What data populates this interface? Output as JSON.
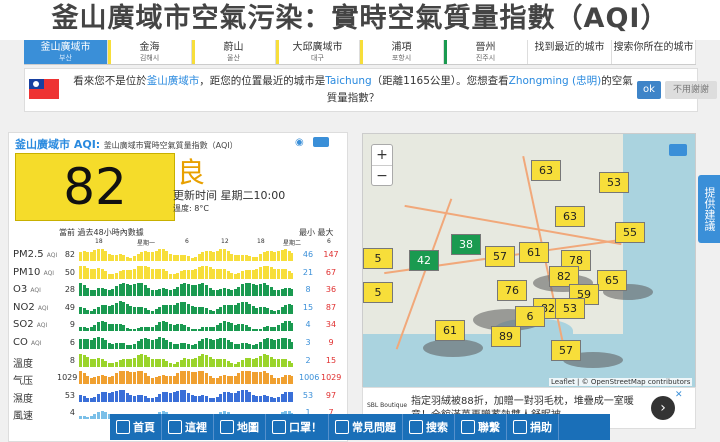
{
  "page_title": "釜山廣域市空氣污染：實時空氣質量指數（AQI）",
  "nav": [
    {
      "label": "釜山廣域市",
      "sub": "부산",
      "active": true,
      "color": ""
    },
    {
      "label": "金海",
      "sub": "김해시",
      "active": false,
      "color": "#f7de3a"
    },
    {
      "label": "蔚山",
      "sub": "울산",
      "active": false,
      "color": "#f7de3a"
    },
    {
      "label": "大邱廣域市",
      "sub": "대구",
      "active": false,
      "color": "#f7de3a"
    },
    {
      "label": "浦項",
      "sub": "포항시",
      "active": false,
      "color": "#f7de3a"
    },
    {
      "label": "晉州",
      "sub": "진주시",
      "active": false,
      "color": "#1a9a50"
    },
    {
      "label": "找到最近的城市",
      "sub": "",
      "active": false,
      "color": ""
    },
    {
      "label": "搜索你所在的城市",
      "sub": "",
      "active": false,
      "color": ""
    }
  ],
  "notice": {
    "part1": "看來您不是位於",
    "city_link": "釜山廣域市",
    "part2": "，距您的位置最近的城市是",
    "near_city": "Taichung",
    "part3": "（距離1165公里）。您想查看",
    "zh_link": "Zhongming (忠明)",
    "part4": "的空氣質量指數？",
    "ok": "ok",
    "no": "不用謝謝"
  },
  "card": {
    "city": "釜山廣域市 AQI:",
    "subtitle": "釜山廣域市實時空氣質量指數（AQI）",
    "aqi": "82",
    "level": "良",
    "updated": "更新时间 星期二10:00",
    "temp": "溫度: 8°C",
    "hdr_now": "當前 過去48小時內數據",
    "hdr_minmax": "最小 最大",
    "ticks": [
      "18",
      "星期一",
      "6",
      "12",
      "18",
      "星期二",
      "6"
    ]
  },
  "rows": [
    {
      "label": "PM2.5",
      "unit": "AQI",
      "current": "82",
      "min": "46",
      "max": "147",
      "color": "#f7de3a",
      "level": 0.6
    },
    {
      "label": "PM10",
      "unit": "AQI",
      "current": "50",
      "min": "21",
      "max": "67",
      "color": "#f7de3a",
      "level": 0.7
    },
    {
      "label": "O3",
      "unit": "AQI",
      "current": "28",
      "min": "8",
      "max": "36",
      "color": "#1a9a50",
      "level": 0.75
    },
    {
      "label": "NO2",
      "unit": "AQI",
      "current": "49",
      "min": "15",
      "max": "87",
      "color": "#1a9a50",
      "level": 0.6
    },
    {
      "label": "SO2",
      "unit": "AQI",
      "current": "9",
      "min": "4",
      "max": "34",
      "color": "#1a9a50",
      "level": 0.45
    },
    {
      "label": "CO",
      "unit": "AQI",
      "current": "6",
      "min": "3",
      "max": "9",
      "color": "#1a9a50",
      "level": 0.6
    },
    {
      "label": "溫度",
      "unit": "",
      "current": "8",
      "min": "2",
      "max": "15",
      "color": "#9ad42a",
      "level": 0.6
    },
    {
      "label": "气压",
      "unit": "",
      "current": "1029",
      "min": "1006",
      "max": "1029",
      "color": "#f0a030",
      "level": 0.8
    },
    {
      "label": "濕度",
      "unit": "",
      "current": "53",
      "min": "53",
      "max": "97",
      "color": "#3a6fd8",
      "level": 0.6
    },
    {
      "label": "風速",
      "unit": "",
      "current": "4",
      "min": "1",
      "max": "7",
      "color": "#7abfe8",
      "level": 0.3
    }
  ],
  "map": {
    "zoom_in": "+",
    "zoom_out": "−",
    "attribution": "Leaflet | © OpenStreetMap contributors",
    "markers": [
      {
        "v": "63",
        "c": "yellow"
      },
      {
        "v": "53",
        "c": "yellow"
      },
      {
        "v": "63",
        "c": "yellow"
      },
      {
        "v": "55",
        "c": "yellow"
      },
      {
        "v": "38",
        "c": "green"
      },
      {
        "v": "42",
        "c": "green"
      },
      {
        "v": "57",
        "c": "yellow"
      },
      {
        "v": "61",
        "c": "yellow"
      },
      {
        "v": "78",
        "c": "yellow"
      },
      {
        "v": "82",
        "c": "yellow"
      },
      {
        "v": "65",
        "c": "yellow"
      },
      {
        "v": "76",
        "c": "yellow"
      },
      {
        "v": "59",
        "c": "yellow"
      },
      {
        "v": "82",
        "c": "yellow"
      },
      {
        "v": "53",
        "c": "yellow"
      },
      {
        "v": "61",
        "c": "yellow"
      },
      {
        "v": "89",
        "c": "yellow"
      },
      {
        "v": "6",
        "c": "yellow"
      },
      {
        "v": "57",
        "c": "yellow"
      },
      {
        "v": "5",
        "c": "yellow"
      },
      {
        "v": "5",
        "c": "yellow"
      }
    ]
  },
  "ad": {
    "logo": "SBL Boutique",
    "text": "指定羽絨被88折，加贈一對羽毛枕，堆疊成一室暖意！全館滿萬再贈蓄熱雙人舒眠被"
  },
  "bottom": [
    "首頁",
    "這裡",
    "地圖",
    "口罩！",
    "常見問題",
    "搜索",
    "聯繫",
    "捐助"
  ],
  "side_tab": "提供建議"
}
